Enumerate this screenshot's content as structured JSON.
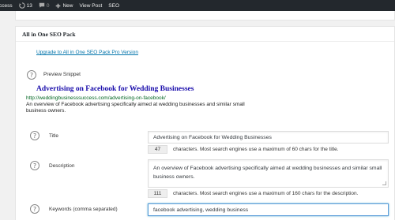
{
  "adminbar": {
    "site_label": "ccess",
    "comments_count": "13",
    "pending_count": "0",
    "new_label": "New",
    "view_post_label": "View Post",
    "seo_label": "SEO"
  },
  "metabox": {
    "title": "All in One SEO Pack",
    "upgrade_link": "Upgrade to All in One SEO Pack Pro Version",
    "preview_label": "Preview Snippet",
    "snippet": {
      "title": "Advertising on Facebook for Wedding Businesses",
      "url": "http://weddingbusinesssuccess.com/advertising-on-facebook/",
      "description": "An overview of Facebook advertising specifically aimed at wedding businesses and similar small business owners."
    },
    "title_field": {
      "label": "Title",
      "value": "Advertising on Facebook for Wedding Businesses",
      "count": "47",
      "hint": "characters. Most search engines use a maximum of 60 chars for the title."
    },
    "description_field": {
      "label": "Description",
      "value": "An overview of Facebook advertising specifically aimed at wedding businesses and similar small business owners.",
      "count": "111",
      "hint": "characters. Most search engines use a maximum of 160 chars for the description."
    },
    "keywords_field": {
      "label": "Keywords (comma separated)",
      "value": "facebook advertising, wedding business"
    },
    "help_glyph": "?"
  },
  "colors": {
    "adminbar_bg": "#23282d",
    "link": "#0073aa",
    "snippet_title": "#1a0dab",
    "snippet_url": "#006621"
  },
  "icons": [
    "comment-icon",
    "plus-icon",
    "help-icon",
    "resize-grip-icon"
  ]
}
